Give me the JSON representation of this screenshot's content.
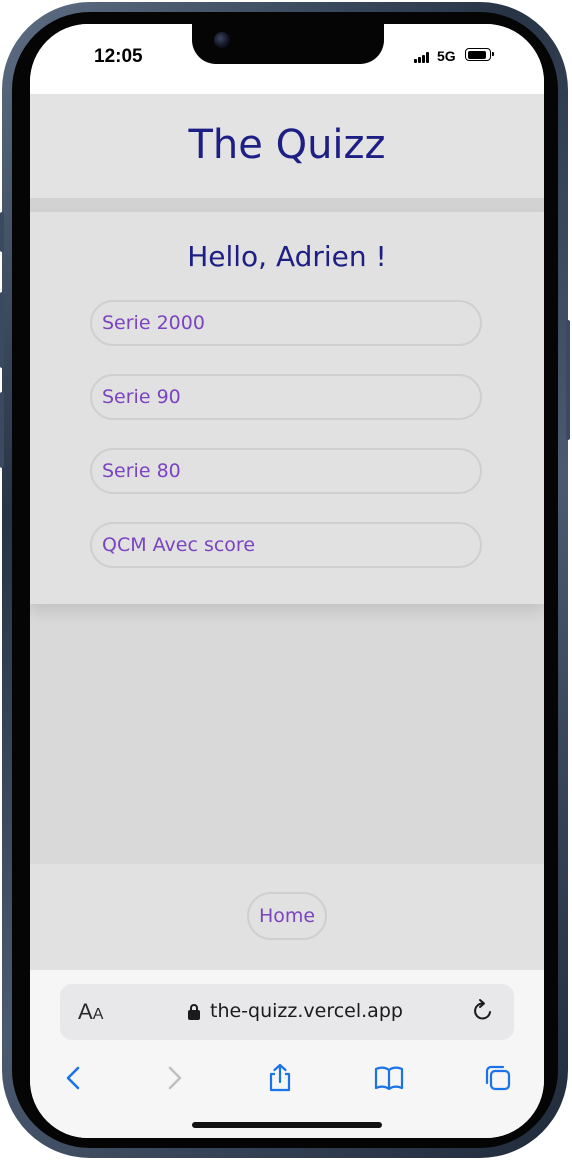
{
  "status_bar": {
    "time": "12:05",
    "network": "5G",
    "battery_level": 0.9
  },
  "app": {
    "title": "The Quizz",
    "greeting": "Hello, Adrien !"
  },
  "quizzes": [
    {
      "label": "Serie 2000"
    },
    {
      "label": "Serie 90"
    },
    {
      "label": "Serie 80"
    },
    {
      "label": "QCM Avec score"
    }
  ],
  "footer": {
    "home_label": "Home"
  },
  "browser": {
    "text_size_label_big": "A",
    "text_size_label_small": "A",
    "url": "the-quizz.vercel.app",
    "icons": [
      "lock-icon",
      "reload-icon",
      "back-icon",
      "forward-icon",
      "share-icon",
      "bookmarks-icon",
      "tabs-icon"
    ]
  },
  "colors": {
    "title": "#1e1f84",
    "button_text": "#7b44c0",
    "browser_blue": "#1a73e8"
  }
}
